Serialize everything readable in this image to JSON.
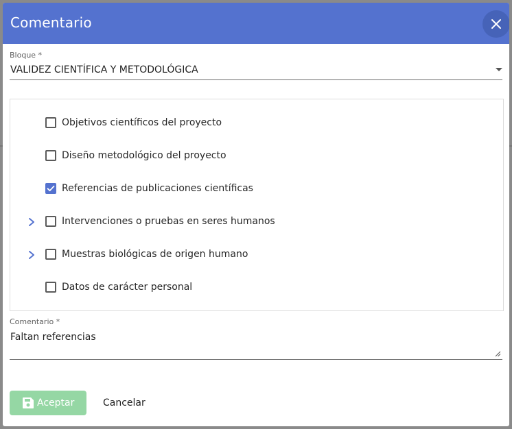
{
  "dialog": {
    "title": "Comentario"
  },
  "bloque": {
    "label": "Bloque *",
    "value": "VALIDEZ CIENTÍFICA Y METODOLÓGICA"
  },
  "tree": {
    "items": [
      {
        "label": "Objetivos científicos del proyecto",
        "checked": false,
        "expandable": false
      },
      {
        "label": "Diseño metodológico del proyecto",
        "checked": false,
        "expandable": false
      },
      {
        "label": "Referencias de publicaciones científicas",
        "checked": true,
        "expandable": false
      },
      {
        "label": "Intervenciones o pruebas en seres humanos",
        "checked": false,
        "expandable": true
      },
      {
        "label": "Muestras biológicas de origen humano",
        "checked": false,
        "expandable": true
      },
      {
        "label": "Datos de carácter personal",
        "checked": false,
        "expandable": false
      }
    ]
  },
  "comentario": {
    "label": "Comentario *",
    "value": "Faltan referencias"
  },
  "actions": {
    "accept_label": "Aceptar",
    "cancel_label": "Cancelar"
  },
  "colors": {
    "header": "#5472cf",
    "accept_button": "#95d7a4",
    "checkbox_checked": "#5472cf"
  }
}
